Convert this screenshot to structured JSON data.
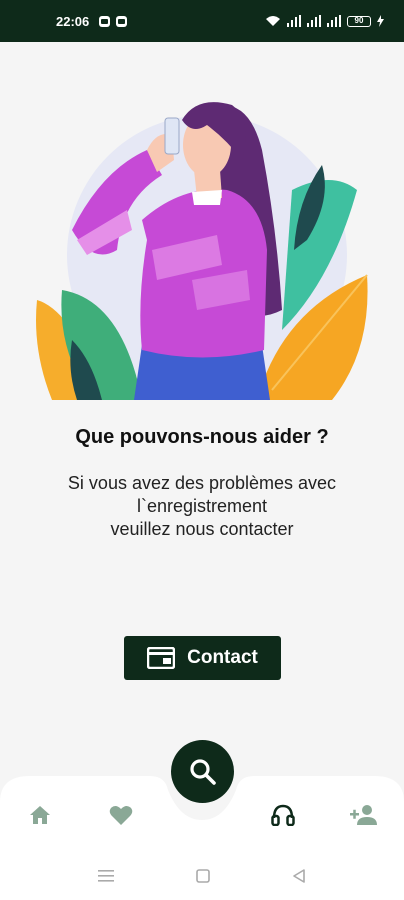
{
  "status_bar": {
    "time": "22:06",
    "battery": "90"
  },
  "main": {
    "title": "Que pouvons-nous aider ?",
    "subtitle_lines": [
      "Si vous avez des problèmes avec",
      "l`enregistrement",
      "veuillez nous contacter"
    ],
    "contact_label": "Contact"
  },
  "bottom_nav": {
    "items": [
      "home-icon",
      "heart-icon",
      "headset-icon",
      "add-person-icon"
    ],
    "fab_icon": "search-icon",
    "inactive_color": "#8aa896",
    "active_color": "#0e2a1a"
  },
  "colors": {
    "primary": "#0e2a1a",
    "background": "#f5f5f5"
  }
}
